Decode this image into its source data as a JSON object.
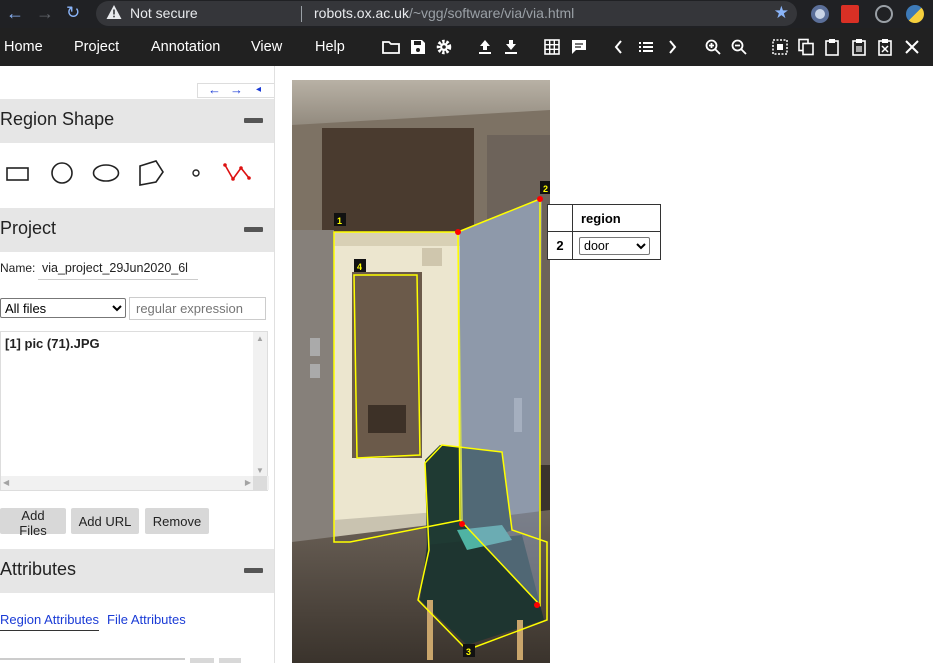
{
  "browser": {
    "security_label": "Not secure",
    "url_host": "robots.ox.ac.uk",
    "url_path": "/~vgg/software/via/via.html"
  },
  "menubar": {
    "items": [
      "Home",
      "Project",
      "Annotation",
      "View",
      "Help"
    ]
  },
  "toolbar_icons": [
    "folder-open-icon",
    "save-icon",
    "gear-icon",
    "upload-icon",
    "download-icon",
    "grid-icon",
    "comment-icon",
    "chevron-left-icon",
    "list-icon",
    "chevron-right-icon",
    "zoom-in-icon",
    "zoom-out-icon",
    "select-all-icon",
    "copy-icon",
    "paste-icon",
    "paste-all-icon",
    "delete-region-icon",
    "close-icon"
  ],
  "left_panel": {
    "nav_arrows": [
      "←",
      "→",
      "◂"
    ],
    "region_shape": {
      "title": "Region Shape",
      "shapes": [
        "rectangle",
        "circle",
        "ellipse",
        "polygon",
        "point",
        "polyline"
      ]
    },
    "project": {
      "title": "Project",
      "name_label": "Name:",
      "name_value": "via_project_29Jun2020_6l",
      "filter_selected": "All files",
      "regex_placeholder": "regular expression",
      "files": [
        "[1] pic (71).JPG"
      ],
      "buttons": {
        "add_files": "Add Files",
        "add_url": "Add URL",
        "remove": "Remove"
      }
    },
    "attributes": {
      "title": "Attributes",
      "tabs": [
        "Region Attributes",
        "File Attributes"
      ]
    }
  },
  "canvas": {
    "region_labels": [
      "1",
      "2",
      "3",
      "4"
    ]
  },
  "annotation_table": {
    "header": "region",
    "row_id": "2",
    "selected_value": "door"
  },
  "colors": {
    "menubar_bg": "#212121",
    "region_outline": "#ffff00",
    "vertex": "#ff0000",
    "selected_region_fill": "#8fa3c8",
    "link": "#1a3bd6"
  }
}
